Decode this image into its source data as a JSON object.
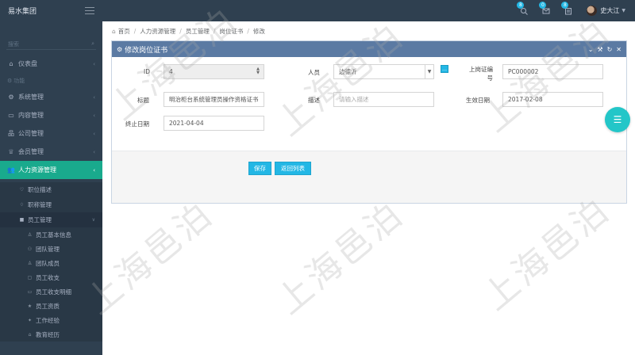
{
  "brand": {
    "name": "易水集团"
  },
  "header": {
    "badges": [
      "8",
      "0",
      "8"
    ],
    "user_name": "史大江"
  },
  "sidebar": {
    "search_placeholder": "搜索",
    "items": [
      {
        "label": "仪表盘",
        "icon": "home-icon"
      },
      {
        "section": "功能"
      },
      {
        "label": "系统管理",
        "icon": "gears-icon"
      },
      {
        "label": "内容管理",
        "icon": "doc-icon"
      },
      {
        "label": "公司管理",
        "icon": "sitemap-icon"
      },
      {
        "label": "会员管理",
        "icon": "trophy-icon"
      },
      {
        "label": "人力资源管理",
        "icon": "users-icon",
        "active": true
      }
    ],
    "hr_sub": [
      {
        "label": "职位描述",
        "icon": "heart-icon"
      },
      {
        "label": "职称管理",
        "icon": "bell-icon"
      },
      {
        "label": "员工管理",
        "icon": "lock-icon",
        "open": true
      }
    ],
    "employee_sub": [
      {
        "label": "员工基本信息",
        "icon": "person-icon"
      },
      {
        "label": "团队管理",
        "icon": "users-icon"
      },
      {
        "label": "团队成员",
        "icon": "user-icon"
      },
      {
        "label": "员工收支",
        "icon": "money-icon"
      },
      {
        "label": "员工收支明细",
        "icon": "list-icon"
      },
      {
        "label": "员工资质",
        "icon": "star-icon"
      },
      {
        "label": "工作经验",
        "icon": "briefcase-icon"
      },
      {
        "label": "教育经历",
        "icon": "cap-icon"
      }
    ]
  },
  "breadcrumb": [
    "首页",
    "人力资源管理",
    "员工管理",
    "岗位证书",
    "修改"
  ],
  "panel": {
    "title": "修改岗位证书",
    "tools": [
      "chevron-down-icon",
      "wrench-icon",
      "refresh-icon",
      "close-icon"
    ]
  },
  "form": {
    "id_label": "ID",
    "id_value": "4",
    "person_label": "人员",
    "person_value": "边德沂",
    "cert_no_label_1": "上岗证编",
    "cert_no_label_2": "号",
    "cert_no_value": "PC000002",
    "title_label": "标题",
    "title_value": "明治柜台系统管理员操作资格证书",
    "desc_label": "描述",
    "desc_placeholder": "请输入描述",
    "effective_label": "生效日期",
    "effective_value": "2017-02-08",
    "end_label": "终止日期",
    "end_value": "2021-04-04"
  },
  "buttons": {
    "save": "保存",
    "back": "返回列表"
  },
  "watermark": "上海邑泊",
  "colors": {
    "sidebar": "#2f4050",
    "active": "#19aa8d",
    "panel_header": "#5b7aa3",
    "accent": "#23b7e5",
    "fab": "#23c6c8"
  }
}
